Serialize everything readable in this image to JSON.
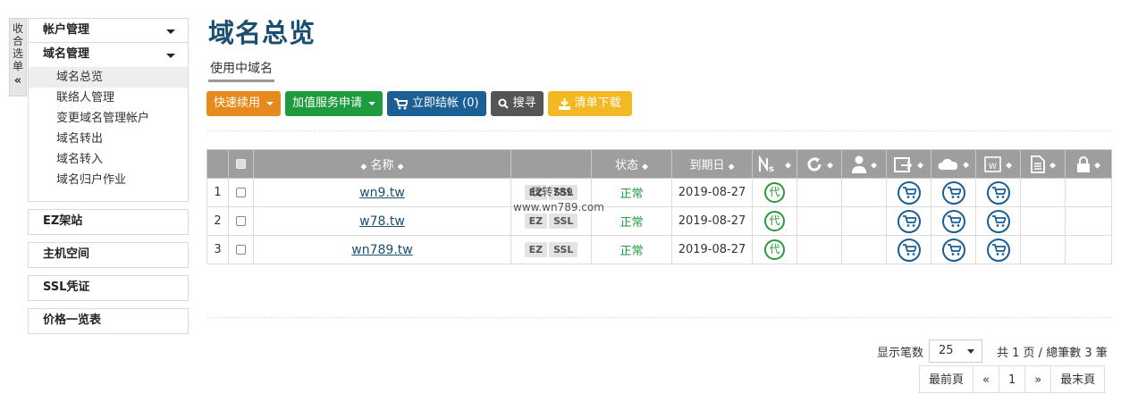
{
  "collapse": {
    "label": "收合选单",
    "arrows": "«"
  },
  "sidebar": {
    "account": "帐户管理",
    "domain_mgmt": "域名管理",
    "sub_items": [
      "域名总览",
      "联络人管理",
      "变更域名管理帐户",
      "域名转出",
      "域名转入",
      "域名归户作业"
    ],
    "ez_site": "EZ架站",
    "hosting": "主机空间",
    "ssl": "SSL凭证",
    "pricing": "价格一览表"
  },
  "page": {
    "title": "域名总览",
    "tab": "使用中域名"
  },
  "toolbar": {
    "quick_renew": "快速续用",
    "value_added": "加值服务申请",
    "checkout": "立即结帐 (0)",
    "search": "搜寻",
    "download": "清单下载"
  },
  "table": {
    "headers": {
      "name": "名称",
      "status": "状态",
      "expiry": "到期日"
    },
    "rows": [
      {
        "num": "1",
        "domain": "wn9.tw",
        "tags": [
          "EZ",
          "SSL"
        ],
        "status": "正常",
        "expiry": "2019-08-27",
        "badge": "代"
      },
      {
        "num": "2",
        "domain": "w78.tw",
        "tags": [
          "EZ",
          "SSL"
        ],
        "status": "正常",
        "expiry": "2019-08-27",
        "badge": "代"
      },
      {
        "num": "3",
        "domain": "wn789.tw",
        "tags": [
          "EZ",
          "SSL"
        ],
        "status": "正常",
        "expiry": "2019-08-27",
        "badge": "代"
      }
    ]
  },
  "watermark": {
    "line1": "玩转789",
    "line2": "www.wn789.com"
  },
  "pagination": {
    "page_size_label": "显示笔数",
    "page_size": "25",
    "totals": "共 1 页 / 總筆數 3 筆",
    "first": "最前頁",
    "prev": "«",
    "current": "1",
    "next": "»",
    "last": "最末頁"
  },
  "colors": {
    "title": "#1b4f72",
    "orange": "#e68a1e",
    "green": "#1e9b3e",
    "blue": "#1c5f95",
    "gray": "#555555",
    "yellow": "#f3b824"
  }
}
